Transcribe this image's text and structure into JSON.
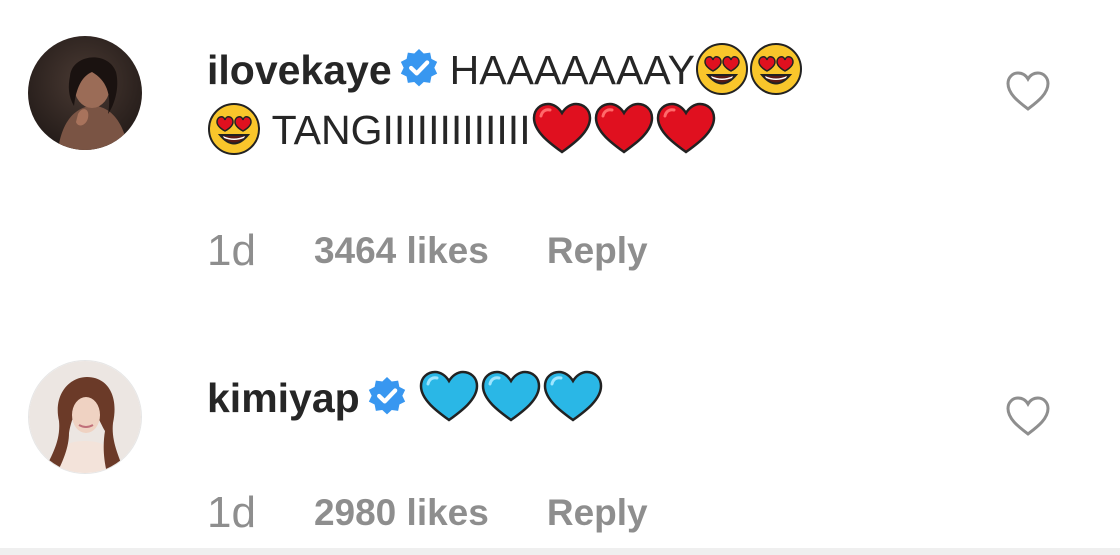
{
  "comments": [
    {
      "username": "ilovekaye",
      "verified": true,
      "text_part1": "HAAAAAAAY",
      "text_part2": "TANGIIIIIIIIIIIII",
      "time": "1d",
      "likes": "3464 likes",
      "reply_label": "Reply",
      "emojis_after_part1": [
        "heart-eyes-emoji",
        "heart-eyes-emoji"
      ],
      "emojis_before_part2": [
        "heart-eyes-emoji"
      ],
      "emojis_after_part2": [
        "red-heart-emoji",
        "red-heart-emoji",
        "red-heart-emoji"
      ]
    },
    {
      "username": "kimiyap",
      "verified": true,
      "text": "",
      "time": "1d",
      "likes": "2980 likes",
      "reply_label": "Reply",
      "emojis": [
        "blue-heart-emoji",
        "blue-heart-emoji",
        "blue-heart-emoji"
      ]
    }
  ],
  "colors": {
    "text": "#262626",
    "muted": "#8e8e8e",
    "verified": "#3897f0",
    "red_heart": "#e0101f",
    "blue_heart": "#2ab7e6"
  }
}
